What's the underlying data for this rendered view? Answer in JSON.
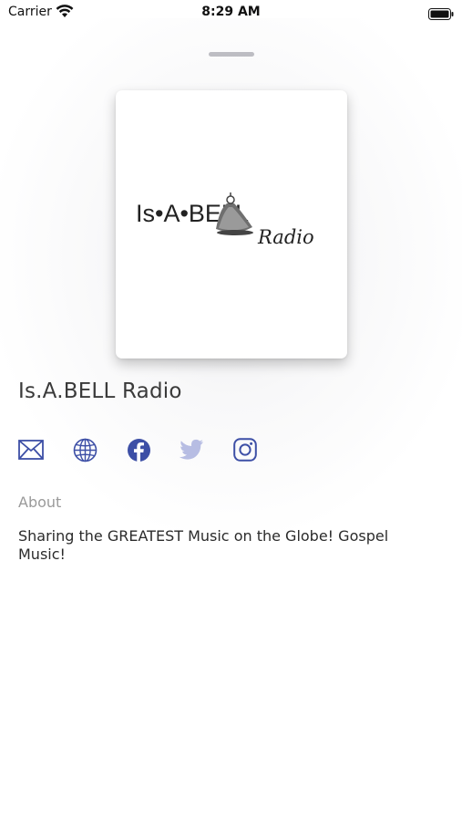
{
  "status_bar": {
    "carrier": "Carrier",
    "time": "8:29 AM"
  },
  "artwork": {
    "logo_text": "Is•A•BELL",
    "logo_subtext": "Radio"
  },
  "station": {
    "title": "Is.A.BELL Radio"
  },
  "social": {
    "icons": [
      "mail-icon",
      "globe-icon",
      "facebook-icon",
      "twitter-icon",
      "instagram-icon"
    ],
    "active_color": "#3d4fa6",
    "disabled_color": "#b7bde3"
  },
  "about": {
    "label": "About",
    "text": "Sharing the GREATEST Music on the Globe! Gospel Music!"
  }
}
